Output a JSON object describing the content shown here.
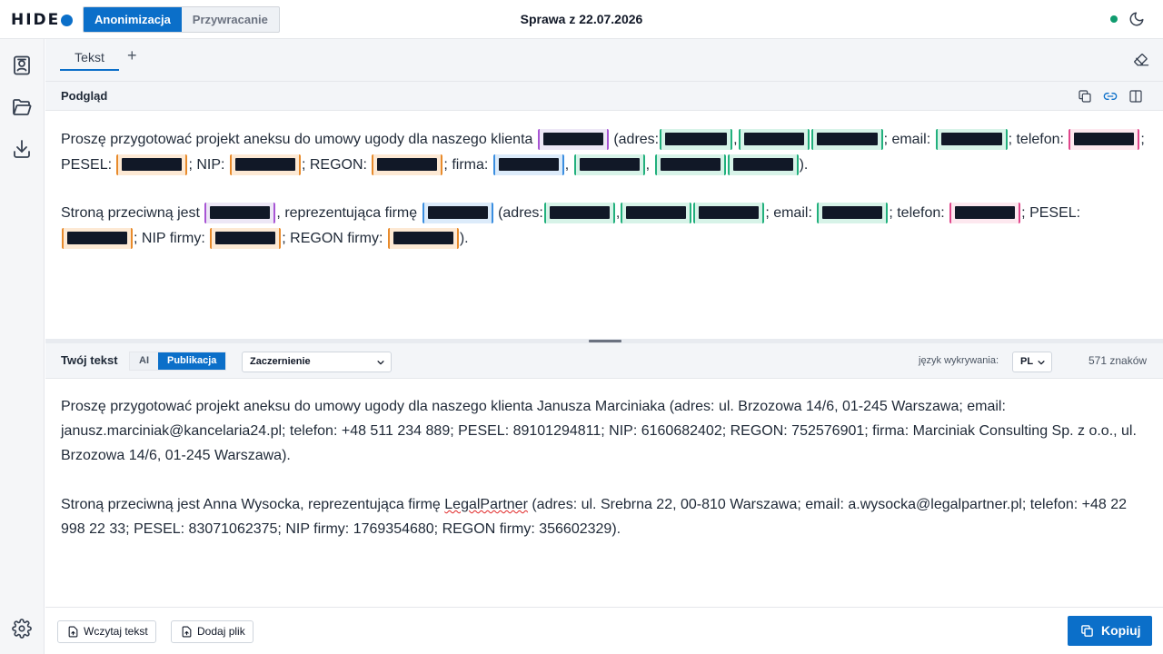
{
  "app": {
    "logo_text": "HIDE",
    "modes": [
      "Anonimizacja",
      "Przywracanie"
    ],
    "active_mode": "Anonimizacja",
    "case_title": "Sprawa z 22.07.2026",
    "status_color": "#0f9b6e",
    "accent_color": "#0b6fc9"
  },
  "sidebar": {
    "icons": [
      "contacts-icon",
      "folder-icon",
      "download-icon",
      "settings-icon"
    ]
  },
  "tabs": {
    "items": [
      "Tekst"
    ],
    "add_label": "+"
  },
  "preview": {
    "title": "Podgląd",
    "p1": {
      "t1": "Proszę przygotować projekt aneksu do umowy ugody dla naszego klienta",
      "t2": "(adres:",
      "t3": ",",
      "t4": "; email:",
      "t5": "; telefon:",
      "t6": "; PESEL:",
      "t7": "; NIP:",
      "t8": "; REGON:",
      "t9": "; firma:",
      "t10": ",",
      "t11": ",",
      "t12": ")."
    },
    "p2": {
      "t1": "Stroną przeciwną jest",
      "t2": ", reprezentująca firmę",
      "t3": "(adres:",
      "t4": ",",
      "t5": "; email:",
      "t6": "; telefon:",
      "t7": "; PESEL:",
      "t8": "; NIP firmy:",
      "t9": "; REGON firmy:",
      "t10": ")."
    }
  },
  "input": {
    "title": "Twój tekst",
    "modes": [
      "AI",
      "Publikacja"
    ],
    "active_mode": "Publikacja",
    "redaction_style": "Zaczernienie",
    "language_label": "język wykrywania:",
    "language": "PL",
    "char_count": "571 znaków",
    "p1": "Proszę przygotować projekt aneksu do umowy ugody dla naszego klienta Janusza Marciniaka (adres: ul. Brzozowa 14/6, 01-245 Warszawa; email: janusz.marciniak@kancelaria24.pl; telefon: +48 511 234 889; PESEL: 89101294811; NIP: 6160682402; REGON: 752576901; firma: Marciniak Consulting Sp. z o.o., ul. Brzozowa 14/6, 01-245 Warszawa).",
    "p2_before": "Stroną przeciwną jest Anna Wysocka, reprezentująca firmę ",
    "p2_flagged": "LegalPartner",
    "p2_after": " (adres: ul. Srebrna 22, 00-810 Warszawa; email: a.wysocka@legalpartner.pl; telefon: +48 22 998 22 33; PESEL: 83071062375; NIP firmy: 1769354680; REGON firmy: 356602329)."
  },
  "footer": {
    "load_text": "Wczytaj tekst",
    "add_file": "Dodaj plik",
    "copy": "Kopiuj"
  }
}
